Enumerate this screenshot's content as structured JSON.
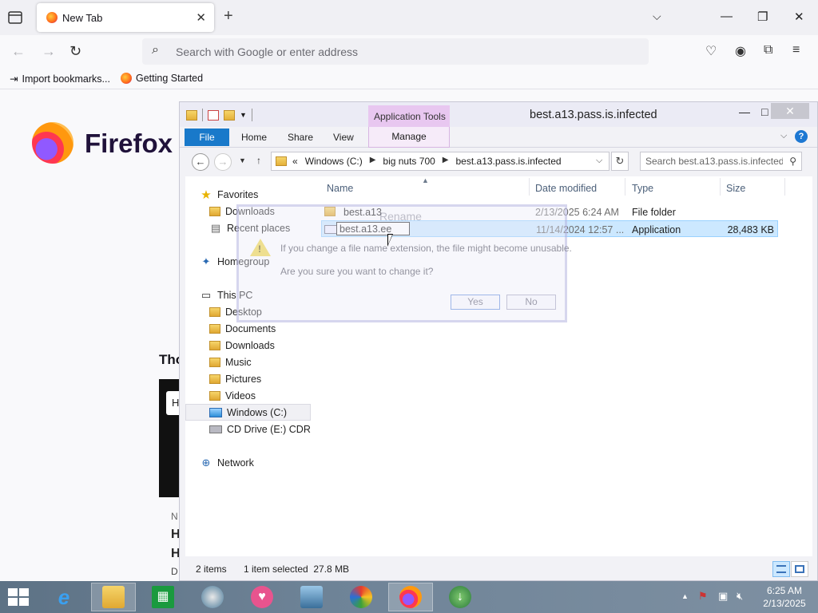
{
  "browser": {
    "tab_title": "New Tab",
    "tab_close": "✕",
    "new_tab": "+",
    "list_tabs": "⌵",
    "url_placeholder": "Search with Google or enter address",
    "bookmarks": [
      {
        "label": "Import bookmarks...",
        "icon": "import-icon"
      },
      {
        "label": "Getting Started",
        "icon": "firefox-favicon"
      }
    ],
    "window_controls": {
      "minimize": "—",
      "maximize": "❐",
      "close": "✕"
    }
  },
  "newtab_page": {
    "wordmark": "Firefox",
    "section_partial": "Tho",
    "card_chip": "H",
    "card_lines": [
      "N",
      "H",
      "H",
      "D"
    ]
  },
  "explorer": {
    "title": "best.a13.pass.is.infected",
    "context_tab": "Application Tools",
    "ribbon_tabs": {
      "file": "File",
      "home": "Home",
      "share": "Share",
      "view": "View",
      "manage": "Manage"
    },
    "breadcrumb_prefix": "«",
    "breadcrumbs": [
      "Windows (C:)",
      "big nuts 700",
      "best.a13.pass.is.infected"
    ],
    "search_placeholder": "Search best.a13.pass.is.infected",
    "nav": {
      "favorites": "Favorites",
      "downloads_fav": "Downloads",
      "recent": "Recent places",
      "homegroup": "Homegroup",
      "this_pc": "This PC",
      "desktop": "Desktop",
      "documents": "Documents",
      "downloads": "Downloads",
      "music": "Music",
      "pictures": "Pictures",
      "videos": "Videos",
      "windows_c": "Windows (C:)",
      "cd_drive": "CD Drive (E:) CDROM",
      "network": "Network"
    },
    "columns": {
      "name": "Name",
      "date": "Date modified",
      "type": "Type",
      "size": "Size"
    },
    "files": [
      {
        "name": "best.a13",
        "date": "2/13/2025 6:24 AM",
        "type": "File folder",
        "size": ""
      },
      {
        "name": "best.a13.ee",
        "date": "11/14/2024 12:57 ...",
        "type": "Application",
        "size": "28,483 KB"
      }
    ],
    "status": {
      "count": "2 items",
      "selection": "1 item selected  27.8 MB"
    }
  },
  "dialog": {
    "title": "Rename",
    "message": "If you change a file name extension, the file might become unusable.",
    "question": "Are you sure you want to change it?",
    "yes": "Yes",
    "no": "No"
  },
  "taskbar": {
    "clock_time": "6:25 AM",
    "clock_date": "2/13/2025",
    "tray_chevron": "▲"
  },
  "colors": {
    "ribbon_file": "#1979ca",
    "app_tools": "#e8c7f0",
    "selection": "#cce8ff",
    "taskbar": "#6e8397"
  }
}
